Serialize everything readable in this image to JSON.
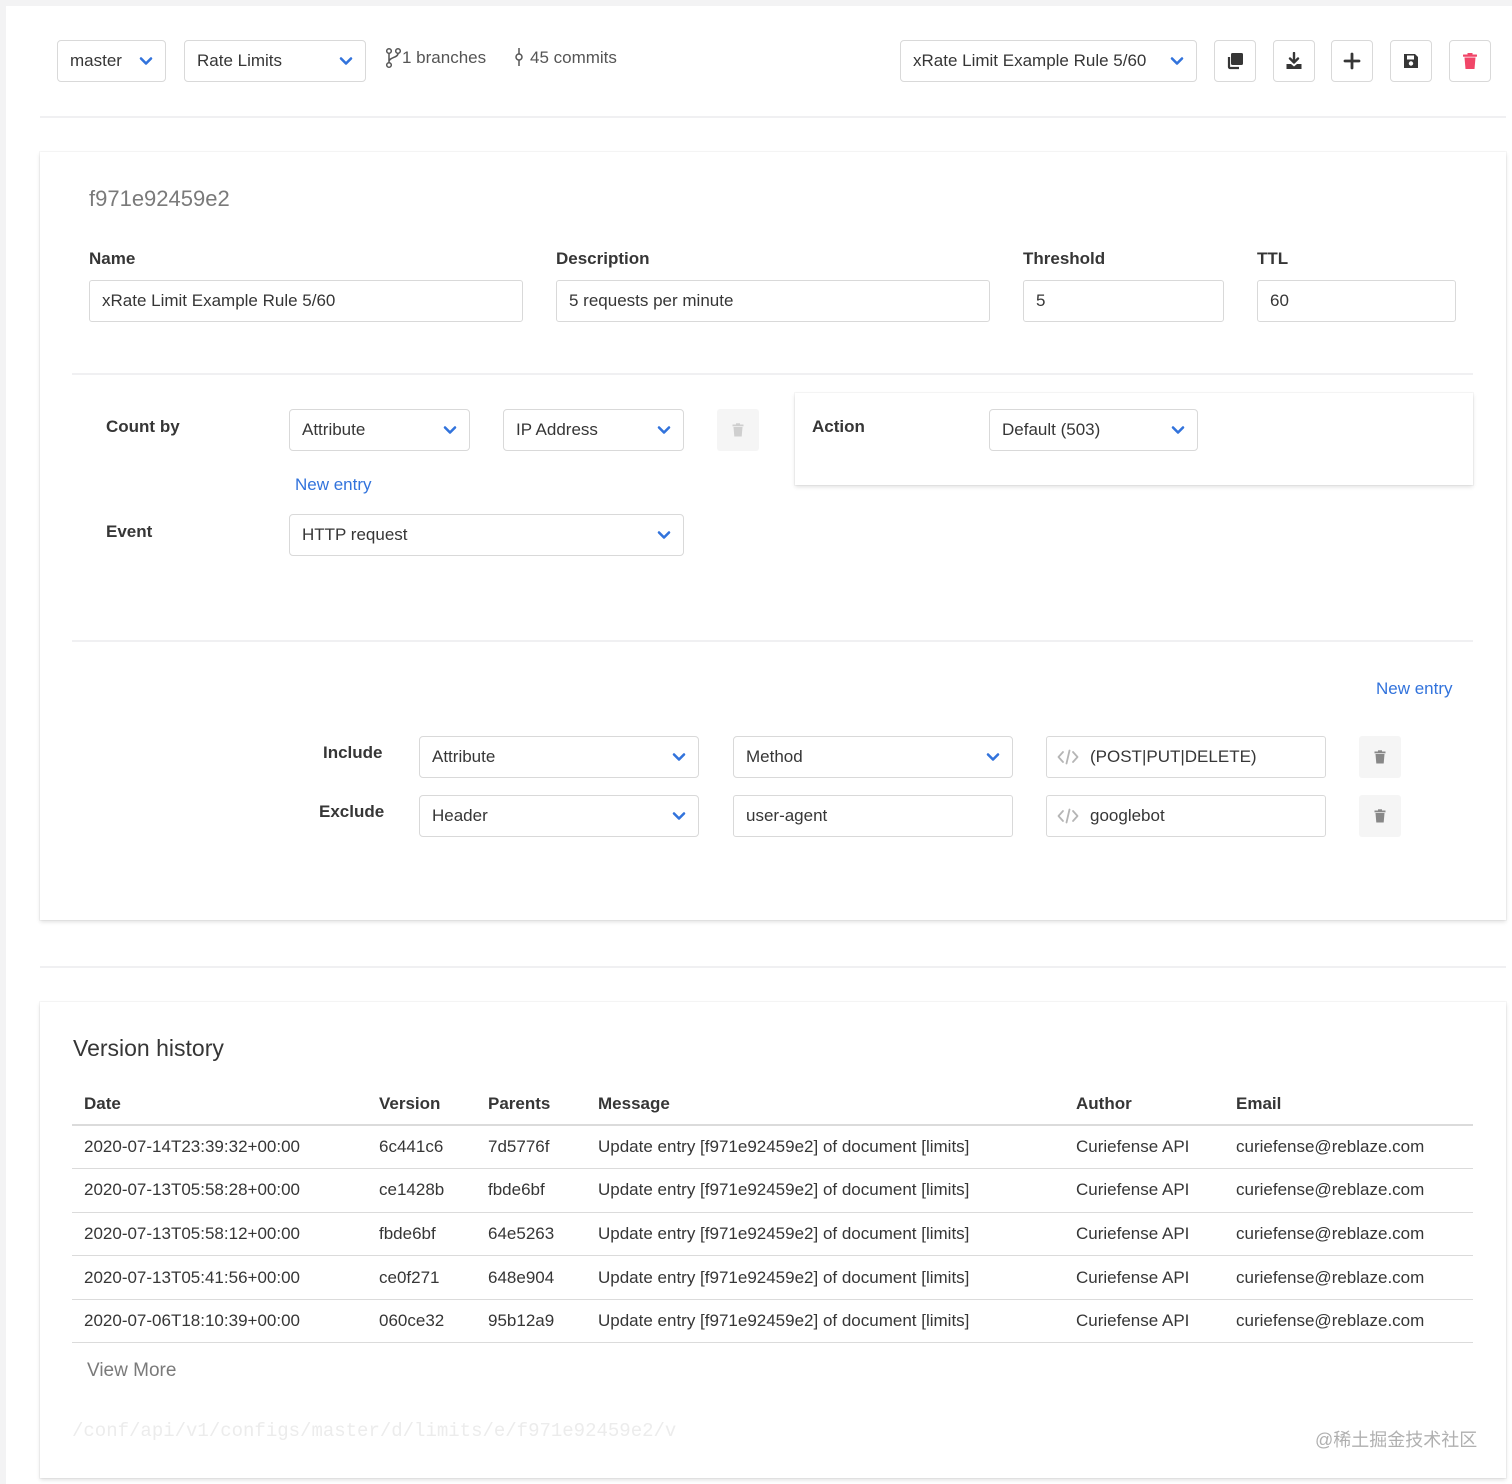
{
  "toolbar": {
    "branch_select": "master",
    "doc_select": "Rate Limits",
    "branches_text": "1 branches",
    "commits_text": "45 commits",
    "entry_select": "xRate Limit Example Rule 5/60"
  },
  "rule": {
    "id": "f971e92459e2",
    "name_label": "Name",
    "name_value": "xRate Limit Example Rule 5/60",
    "description_label": "Description",
    "description_value": "5 requests per minute",
    "threshold_label": "Threshold",
    "threshold_value": "5",
    "ttl_label": "TTL",
    "ttl_value": "60",
    "count_by_label": "Count by",
    "count_by_type": "Attribute",
    "count_by_value": "IP Address",
    "new_entry_label": "New entry",
    "event_label": "Event",
    "event_value": "HTTP request",
    "action_label": "Action",
    "action_value": "Default (503)",
    "filters_new_entry_label": "New entry",
    "include_label": "Include",
    "include_type": "Attribute",
    "include_key": "Method",
    "include_value": "(POST|PUT|DELETE)",
    "exclude_label": "Exclude",
    "exclude_type": "Header",
    "exclude_key": "user-agent",
    "exclude_value": "googlebot"
  },
  "history": {
    "title": "Version history",
    "columns": [
      "Date",
      "Version",
      "Parents",
      "Message",
      "Author",
      "Email"
    ],
    "rows": [
      [
        "2020-07-14T23:39:32+00:00",
        "6c441c6",
        "7d5776f",
        "Update entry [f971e92459e2] of document [limits]",
        "Curiefense API",
        "curiefense@reblaze.com"
      ],
      [
        "2020-07-13T05:58:28+00:00",
        "ce1428b",
        "fbde6bf",
        "Update entry [f971e92459e2] of document [limits]",
        "Curiefense API",
        "curiefense@reblaze.com"
      ],
      [
        "2020-07-13T05:58:12+00:00",
        "fbde6bf",
        "64e5263",
        "Update entry [f971e92459e2] of document [limits]",
        "Curiefense API",
        "curiefense@reblaze.com"
      ],
      [
        "2020-07-13T05:41:56+00:00",
        "ce0f271",
        "648e904",
        "Update entry [f971e92459e2] of document [limits]",
        "Curiefense API",
        "curiefense@reblaze.com"
      ],
      [
        "2020-07-06T18:10:39+00:00",
        "060ce32",
        "95b12a9",
        "Update entry [f971e92459e2] of document [limits]",
        "Curiefense API",
        "curiefense@reblaze.com"
      ]
    ],
    "view_more": "View More",
    "api_path": "/conf/api/v1/configs/master/d/limits/e/f971e92459e2/v"
  },
  "watermark": "@稀土掘金技术社区",
  "colors": {
    "accent": "#3273dc",
    "danger": "#f14668",
    "border": "#d9d9d9"
  }
}
